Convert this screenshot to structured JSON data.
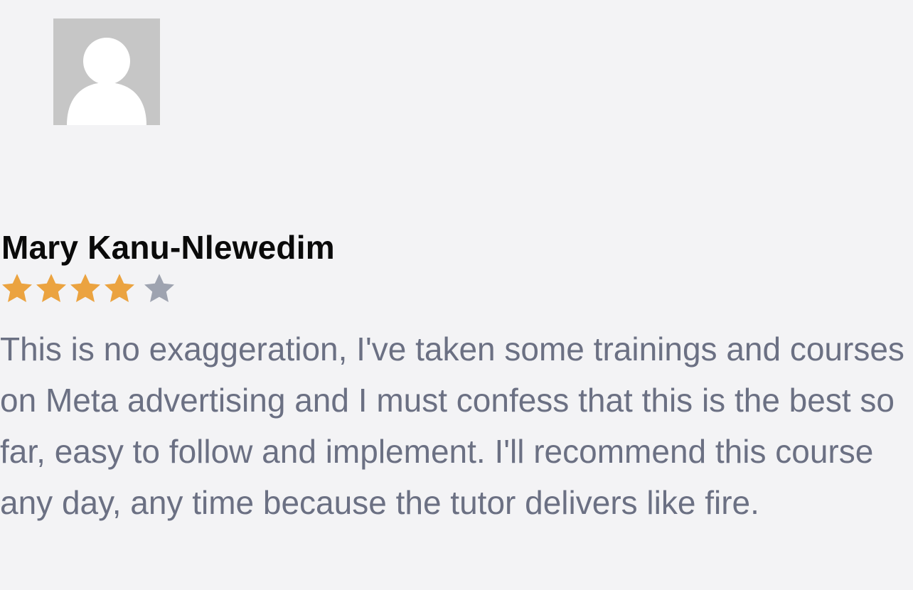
{
  "review": {
    "reviewer_name": "Mary Kanu-Nlewedim",
    "rating": 4,
    "rating_max": 5,
    "text": "This is no exaggeration, I've taken some trainings and courses on Meta advertising and I must confess that this is the best so far, easy to follow and implement. I'll recommend this course any day, any time because the tutor delivers like fire."
  },
  "colors": {
    "star_filled": "#eba340",
    "star_empty": "#9ea3b0",
    "name": "#0a0a0a",
    "body_text": "#6b7083",
    "avatar_bg": "#c6c6c6",
    "page_bg": "#f3f3f5"
  },
  "icons": {
    "avatar": "default-user-avatar-icon",
    "star": "star-icon"
  }
}
